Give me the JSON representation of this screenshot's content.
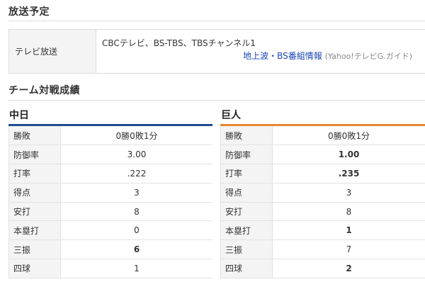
{
  "broadcast": {
    "title": "放送予定",
    "label": "テレビ放送",
    "channels": "CBCテレビ、BS-TBS、TBSチャンネル1",
    "link_text": "地上波・BS番組情報",
    "source": "(Yahoo!テレビG.ガイド)"
  },
  "matchup": {
    "title": "チーム対戦成績",
    "teams": [
      {
        "name": "中日",
        "color": "#1d4e8f",
        "stats": [
          {
            "label": "勝敗",
            "value": "0勝0敗1分",
            "bold": false
          },
          {
            "label": "防御率",
            "value": "3.00",
            "bold": false
          },
          {
            "label": "打率",
            "value": ".222",
            "bold": false
          },
          {
            "label": "得点",
            "value": "3",
            "bold": false
          },
          {
            "label": "安打",
            "value": "8",
            "bold": false
          },
          {
            "label": "本塁打",
            "value": "0",
            "bold": false
          },
          {
            "label": "三振",
            "value": "6",
            "bold": true
          },
          {
            "label": "四球",
            "value": "1",
            "bold": false
          }
        ]
      },
      {
        "name": "巨人",
        "color": "#e8862e",
        "stats": [
          {
            "label": "勝敗",
            "value": "0勝0敗1分",
            "bold": false
          },
          {
            "label": "防御率",
            "value": "1.00",
            "bold": true
          },
          {
            "label": "打率",
            "value": ".235",
            "bold": true
          },
          {
            "label": "得点",
            "value": "3",
            "bold": false
          },
          {
            "label": "安打",
            "value": "8",
            "bold": false
          },
          {
            "label": "本塁打",
            "value": "1",
            "bold": true
          },
          {
            "label": "三振",
            "value": "7",
            "bold": false
          },
          {
            "label": "四球",
            "value": "2",
            "bold": true
          }
        ]
      }
    ]
  }
}
